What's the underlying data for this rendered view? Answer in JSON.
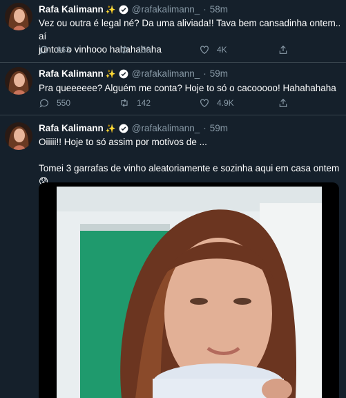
{
  "user": {
    "name": "Rafa Kalimann",
    "sparkle": "✨",
    "handle": "@rafakalimann_"
  },
  "tweets": [
    {
      "time": "58m",
      "text_lines": [
        "Vez ou outra é legal né? Da uma aliviada!! Tava bem cansadinha ontem.. aí",
        "juntou o vinhooo hahahahaha"
      ],
      "replies": "663",
      "retweets": "150",
      "likes": "4K"
    },
    {
      "time": "59m",
      "text_lines": [
        "Pra queeeeee? Alguém me conta? Hoje to só o cacooooo! Hahahahaha"
      ],
      "replies": "550",
      "retweets": "142",
      "likes": "4.9K"
    },
    {
      "time": "59m",
      "text_lines": [
        "Oiiiii!! Hoje to só assim por motivos de ...",
        "",
        "Tomei 3 garrafas de vinho aleatoriamente e sozinha aqui em casa ontem 😰",
        "😩"
      ]
    }
  ],
  "colors": {
    "bg": "#15202b",
    "muted": "#8899a6",
    "verified": "#1da1f2",
    "divider": "#38444d"
  }
}
